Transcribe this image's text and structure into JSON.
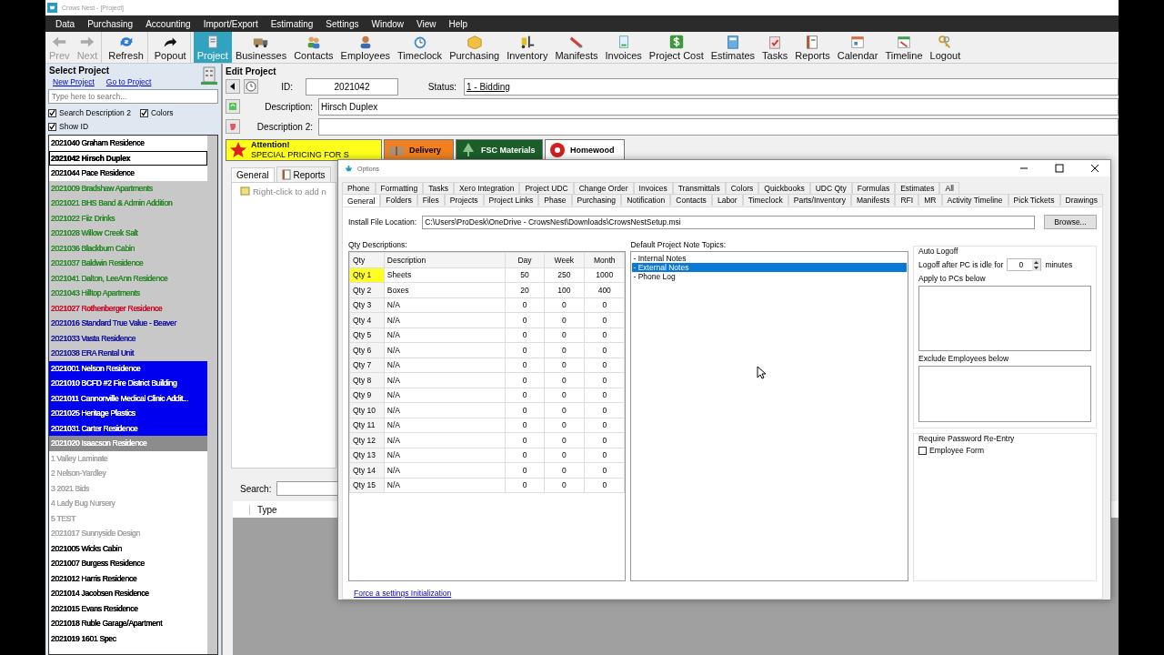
{
  "window": {
    "title": "Crows Nest - [Project]"
  },
  "menu": [
    "Data",
    "Purchasing",
    "Accounting",
    "Import/Export",
    "Estimating",
    "Settings",
    "Window",
    "View",
    "Help"
  ],
  "toolbar": [
    {
      "label": "Prev",
      "disabled": true,
      "selected": false
    },
    {
      "label": "Next",
      "disabled": true,
      "selected": false
    },
    {
      "label": "Refresh",
      "disabled": false,
      "selected": false
    },
    {
      "label": "Popout",
      "disabled": false,
      "selected": false
    },
    {
      "label": "Project",
      "disabled": false,
      "selected": true
    },
    {
      "label": "Businesses",
      "disabled": false,
      "selected": false
    },
    {
      "label": "Contacts",
      "disabled": false,
      "selected": false
    },
    {
      "label": "Employees",
      "disabled": false,
      "selected": false
    },
    {
      "label": "Timeclock",
      "disabled": false,
      "selected": false
    },
    {
      "label": "Purchasing",
      "disabled": false,
      "selected": false
    },
    {
      "label": "Inventory",
      "disabled": false,
      "selected": false
    },
    {
      "label": "Manifests",
      "disabled": false,
      "selected": false
    },
    {
      "label": "Invoices",
      "disabled": false,
      "selected": false
    },
    {
      "label": "Project Cost",
      "disabled": false,
      "selected": false
    },
    {
      "label": "Estimates",
      "disabled": false,
      "selected": false
    },
    {
      "label": "Tasks",
      "disabled": false,
      "selected": false
    },
    {
      "label": "Reports",
      "disabled": false,
      "selected": false
    },
    {
      "label": "Calendar",
      "disabled": false,
      "selected": false
    },
    {
      "label": "Timeline",
      "disabled": false,
      "selected": false
    },
    {
      "label": "Logout",
      "disabled": false,
      "selected": false
    }
  ],
  "select_project": {
    "title": "Select Project",
    "links": [
      "New Project",
      "Go to Project"
    ],
    "search": {
      "placeholder": "Type here to search..."
    },
    "options": [
      {
        "label": "Search Description 2",
        "checked": true
      },
      {
        "label": "Colors",
        "checked": true
      },
      {
        "label": "Show ID",
        "checked": true
      }
    ],
    "projects": [
      {
        "label": "2021040 Graham Residence",
        "color": "#000000",
        "kind": "normal",
        "selected": false
      },
      {
        "label": "2021042 Hirsch Duplex",
        "color": "#000000",
        "kind": "normal",
        "selected": true
      },
      {
        "label": "2021044 Pace Residence",
        "color": "#000000",
        "kind": "normal",
        "selected": false
      },
      {
        "label": "2021009 Bradshaw Apartments",
        "color": "#2e8b2e",
        "kind": "grouped",
        "selected": false
      },
      {
        "label": "2021021 BHS Band & Admin Addition",
        "color": "#2e8b2e",
        "kind": "grouped",
        "selected": false
      },
      {
        "label": "2021022 Fiiz Drinks",
        "color": "#2e8b2e",
        "kind": "grouped",
        "selected": false
      },
      {
        "label": "2021028 Willow Creek Salt",
        "color": "#2e8b2e",
        "kind": "grouped",
        "selected": false
      },
      {
        "label": "2021036 Blackburn Cabin",
        "color": "#2e8b2e",
        "kind": "grouped",
        "selected": false
      },
      {
        "label": "2021037 Baldwin Residence",
        "color": "#2e8b2e",
        "kind": "grouped",
        "selected": false
      },
      {
        "label": "2021041 Dalton, LeeAnn Residence",
        "color": "#2e8b2e",
        "kind": "grouped",
        "selected": false
      },
      {
        "label": "2021043 Hilltop Apartments",
        "color": "#2e8b2e",
        "kind": "grouped",
        "selected": false
      },
      {
        "label": "2021027 Rothenberger Residence",
        "color": "#d0102a",
        "kind": "grouped",
        "selected": false
      },
      {
        "label": "2021016 Standard True Value - Beaver",
        "color": "#1a1aa8",
        "kind": "grouped",
        "selected": false
      },
      {
        "label": "2021033 Vasta Residence",
        "color": "#1a1aa8",
        "kind": "grouped",
        "selected": false
      },
      {
        "label": "2021038 ERA Rental Unit",
        "color": "#1a1aa8",
        "kind": "grouped",
        "selected": false
      },
      {
        "label": "2021001 Nelson Residence",
        "color": "#ffffff",
        "kind": "highlighted",
        "selected": false
      },
      {
        "label": "2021010 BCFD #2 Fire District Building",
        "color": "#ffffff",
        "kind": "highlighted",
        "selected": false
      },
      {
        "label": "2021011 Cannonville Medical Clinic Addit...",
        "color": "#ffffff",
        "kind": "highlighted",
        "selected": false
      },
      {
        "label": "2021025 Heritage Plastics",
        "color": "#ffffff",
        "kind": "highlighted",
        "selected": false
      },
      {
        "label": "2021031 Carter Residence",
        "color": "#ffffff",
        "kind": "highlighted",
        "selected": false
      },
      {
        "label": "2021020 Isaacson Residence",
        "color": "#ffffff",
        "kind": "dimmed",
        "selected": false
      },
      {
        "label": "1 Valley Laminate",
        "color": "#a8a8a8",
        "kind": "normal",
        "selected": false
      },
      {
        "label": "2 Nelson-Yardley",
        "color": "#a8a8a8",
        "kind": "normal",
        "selected": false
      },
      {
        "label": "3 2021 Bids",
        "color": "#a8a8a8",
        "kind": "normal",
        "selected": false
      },
      {
        "label": "4 Lady Bug Nursery",
        "color": "#a8a8a8",
        "kind": "normal",
        "selected": false
      },
      {
        "label": "5 TEST",
        "color": "#a8a8a8",
        "kind": "normal",
        "selected": false
      },
      {
        "label": "2021017 Sunnyside Design",
        "color": "#a8a8a8",
        "kind": "normal",
        "selected": false
      },
      {
        "label": "2021005 Wicks Cabin",
        "color": "#000000",
        "kind": "normal",
        "selected": false
      },
      {
        "label": "2021007 Burgess Residence",
        "color": "#000000",
        "kind": "normal",
        "selected": false
      },
      {
        "label": "2021012 Harris Residence",
        "color": "#000000",
        "kind": "normal",
        "selected": false
      },
      {
        "label": "2021014 Jacobsen Residence",
        "color": "#000000",
        "kind": "normal",
        "selected": false
      },
      {
        "label": "2021015 Evans Residence",
        "color": "#000000",
        "kind": "normal",
        "selected": false
      },
      {
        "label": "2021018 Ruble Garage/Apartment",
        "color": "#000000",
        "kind": "normal",
        "selected": false
      },
      {
        "label": "2021019 1601 Spec",
        "color": "#000000",
        "kind": "normal",
        "selected": false
      }
    ]
  },
  "edit_project": {
    "title": "Edit Project",
    "id_label": "ID:",
    "id": "2021042",
    "status_label": "Status:",
    "status": "1 - Bidding",
    "description_label": "Description:",
    "description": "Hirsch Duplex",
    "description2_label": "Description 2:",
    "banners": [
      {
        "kind": "attention",
        "title": "Attention!",
        "subtitle": "SPECIAL PRICING FOR S"
      },
      {
        "kind": "delivery",
        "title": "Delivery"
      },
      {
        "kind": "fsc",
        "title": "FSC Materials"
      },
      {
        "kind": "homewood",
        "title": "Homewood"
      }
    ],
    "tabs": [
      {
        "label": "General",
        "selected": true
      },
      {
        "label": "Reports",
        "selected": false
      }
    ],
    "tree_hint": "Right-click to add n",
    "search_label": "Search:",
    "grid_columns": [
      "Type"
    ]
  },
  "options_dialog": {
    "title": "Options",
    "tab_rows": [
      [
        {
          "label": "Phone",
          "selected": false
        },
        {
          "label": "Formatting",
          "selected": false
        },
        {
          "label": "Tasks",
          "selected": false
        },
        {
          "label": "Xero Integration",
          "selected": false
        },
        {
          "label": "Project UDC",
          "selected": false
        },
        {
          "label": "Change Order",
          "selected": false
        },
        {
          "label": "Invoices",
          "selected": false
        },
        {
          "label": "Transmittals",
          "selected": false
        },
        {
          "label": "Colors",
          "selected": false
        },
        {
          "label": "Quickbooks",
          "selected": false
        },
        {
          "label": "UDC Qty",
          "selected": false
        },
        {
          "label": "Formulas",
          "selected": false
        },
        {
          "label": "Estimates",
          "selected": false
        },
        {
          "label": "All",
          "selected": false
        }
      ],
      [
        {
          "label": "General",
          "selected": true
        },
        {
          "label": "Folders",
          "selected": false
        },
        {
          "label": "Files",
          "selected": false
        },
        {
          "label": "Projects",
          "selected": false
        },
        {
          "label": "Project Links",
          "selected": false
        },
        {
          "label": "Phase",
          "selected": false
        },
        {
          "label": "Purchasing",
          "selected": false
        },
        {
          "label": "Notification",
          "selected": false
        },
        {
          "label": "Contacts",
          "selected": false
        },
        {
          "label": "Labor",
          "selected": false
        },
        {
          "label": "Timeclock",
          "selected": false
        },
        {
          "label": "Parts/Inventory",
          "selected": false
        },
        {
          "label": "Manifests",
          "selected": false
        },
        {
          "label": "RFI",
          "selected": false
        },
        {
          "label": "MR",
          "selected": false
        },
        {
          "label": "Activity Timeline",
          "selected": false
        },
        {
          "label": "Pick Tickets",
          "selected": false
        },
        {
          "label": "Drawings",
          "selected": false
        }
      ]
    ],
    "install_label": "Install File Location:",
    "install_path": "C:\\Users\\ProDesk\\OneDrive - CrowsNest\\Downloads\\CrowsNestSetup.msi",
    "browse": "Browse...",
    "qty_title": "Qty Descriptions:",
    "qty_table": {
      "columns": [
        "Qty",
        "Description",
        "Day",
        "Week",
        "Month"
      ],
      "rows": [
        {
          "cells": [
            "Qty 1",
            "Sheets",
            "50",
            "250",
            "1000"
          ],
          "selected": true
        },
        {
          "cells": [
            "Qty 2",
            "Boxes",
            "20",
            "100",
            "400"
          ],
          "selected": false
        },
        {
          "cells": [
            "Qty 3",
            "N/A",
            "0",
            "0",
            "0"
          ],
          "selected": false
        },
        {
          "cells": [
            "Qty 4",
            "N/A",
            "0",
            "0",
            "0"
          ],
          "selected": false
        },
        {
          "cells": [
            "Qty 5",
            "N/A",
            "0",
            "0",
            "0"
          ],
          "selected": false
        },
        {
          "cells": [
            "Qty 6",
            "N/A",
            "0",
            "0",
            "0"
          ],
          "selected": false
        },
        {
          "cells": [
            "Qty 7",
            "N/A",
            "0",
            "0",
            "0"
          ],
          "selected": false
        },
        {
          "cells": [
            "Qty 8",
            "N/A",
            "0",
            "0",
            "0"
          ],
          "selected": false
        },
        {
          "cells": [
            "Qty 9",
            "N/A",
            "0",
            "0",
            "0"
          ],
          "selected": false
        },
        {
          "cells": [
            "Qty 10",
            "N/A",
            "0",
            "0",
            "0"
          ],
          "selected": false
        },
        {
          "cells": [
            "Qty 11",
            "N/A",
            "0",
            "0",
            "0"
          ],
          "selected": false
        },
        {
          "cells": [
            "Qty 12",
            "N/A",
            "0",
            "0",
            "0"
          ],
          "selected": false
        },
        {
          "cells": [
            "Qty 13",
            "N/A",
            "0",
            "0",
            "0"
          ],
          "selected": false
        },
        {
          "cells": [
            "Qty 14",
            "N/A",
            "0",
            "0",
            "0"
          ],
          "selected": false
        },
        {
          "cells": [
            "Qty 15",
            "N/A",
            "0",
            "0",
            "0"
          ],
          "selected": false
        }
      ]
    },
    "note_topics": {
      "title": "Default Project Note Topics:",
      "items": [
        {
          "label": "- Internal Notes",
          "selected": false
        },
        {
          "label": "- External Notes",
          "selected": true
        },
        {
          "label": "- Phone Log",
          "selected": false
        }
      ]
    },
    "auto_logoff": {
      "title": "Auto Logoff",
      "idle_label": "Logoff after PC is idle for",
      "idle_minutes": "0",
      "unit": "minutes",
      "apply_label": "Apply to PCs below",
      "exclude_label": "Exclude Employees below"
    },
    "password": {
      "title": "Require Password Re-Entry",
      "options": [
        {
          "label": "Employee Form",
          "checked": false
        }
      ]
    },
    "link": "Force a settings Initialization"
  }
}
